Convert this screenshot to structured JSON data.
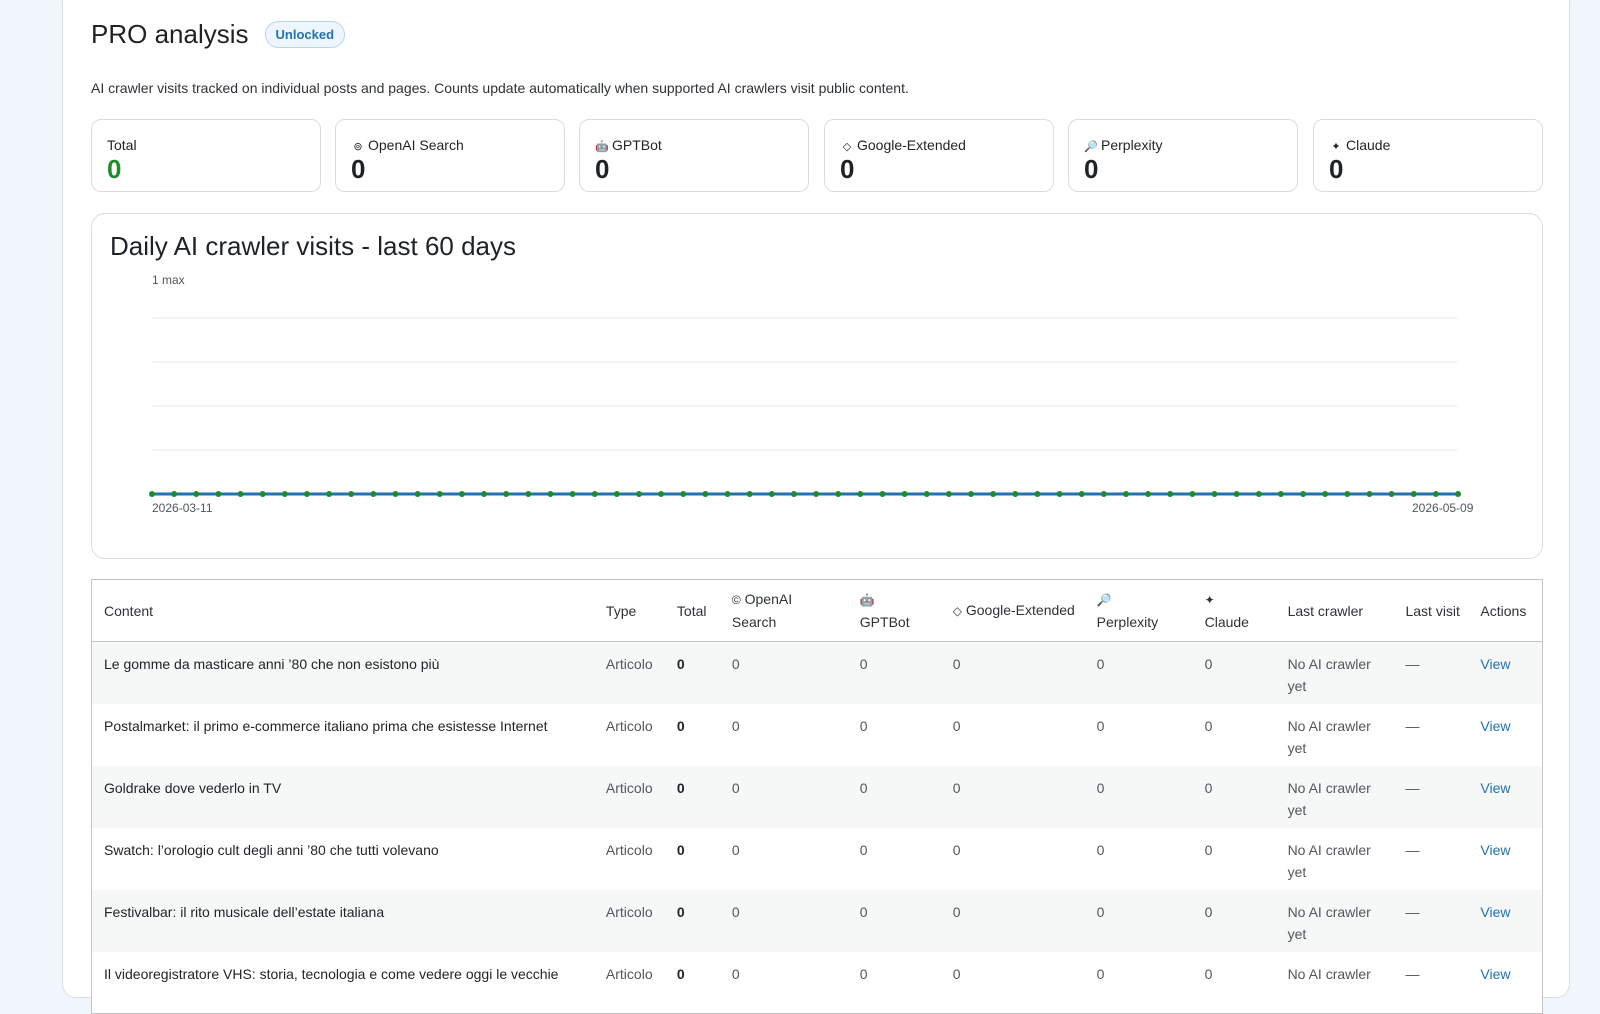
{
  "header": {
    "title": "PRO analysis",
    "badge": "Unlocked",
    "description": "AI crawler visits tracked on individual posts and pages. Counts update automatically when supported AI crawlers visit public content."
  },
  "stats": [
    {
      "label": "Total",
      "icon": "",
      "icon_name": "",
      "value": "0"
    },
    {
      "label": "OpenAI Search",
      "icon": "⊚",
      "icon_name": "openai-icon",
      "value": "0"
    },
    {
      "label": "GPTBot",
      "icon": "🤖",
      "icon_name": "robot-icon",
      "value": "0"
    },
    {
      "label": "Google-Extended",
      "icon": "◇",
      "icon_name": "diamond-icon",
      "value": "0"
    },
    {
      "label": "Perplexity",
      "icon": "🔎",
      "icon_name": "magnifier-icon",
      "value": "0"
    },
    {
      "label": "Claude",
      "icon": "✦",
      "icon_name": "sparkle-icon",
      "value": "0"
    }
  ],
  "chart": {
    "title": "Daily AI crawler visits - last 60 days",
    "max_label": "1 max",
    "start_label": "2026-03-11",
    "end_label": "2026-05-09"
  },
  "chart_data": {
    "type": "line",
    "title": "Daily AI crawler visits - last 60 days",
    "x_start": "2026-03-11",
    "x_end": "2026-05-09",
    "points": 60,
    "ylim": [
      0,
      1
    ],
    "series": [
      {
        "values": [
          0,
          0,
          0,
          0,
          0,
          0,
          0,
          0,
          0,
          0,
          0,
          0,
          0,
          0,
          0,
          0,
          0,
          0,
          0,
          0,
          0,
          0,
          0,
          0,
          0,
          0,
          0,
          0,
          0,
          0,
          0,
          0,
          0,
          0,
          0,
          0,
          0,
          0,
          0,
          0,
          0,
          0,
          0,
          0,
          0,
          0,
          0,
          0,
          0,
          0,
          0,
          0,
          0,
          0,
          0,
          0,
          0,
          0,
          0,
          0
        ]
      }
    ],
    "grid": true,
    "line_color": "#2271b1",
    "marker_color": "#1e8c2c"
  },
  "table": {
    "headers": {
      "content": "Content",
      "type": "Type",
      "total": "Total",
      "openai_icon": "©",
      "openai": "OpenAI Search",
      "gptbot_icon": "🤖",
      "gptbot": "GPTBot",
      "google_icon": "◇",
      "google": "Google-Extended",
      "perplexity_icon": "🔎",
      "perplexity": "Perplexity",
      "claude_icon": "✦",
      "claude": "Claude",
      "last_crawler": "Last crawler",
      "last_visit": "Last visit",
      "actions": "Actions"
    },
    "rows": [
      {
        "content": "Le gomme da masticare anni ’80 che non esistono più",
        "type": "Articolo",
        "total": "0",
        "openai": "0",
        "gptbot": "0",
        "google": "0",
        "perplexity": "0",
        "claude": "0",
        "last_crawler": "No AI crawler yet",
        "last_visit": "—",
        "action": "View"
      },
      {
        "content": "Postalmarket: il primo e-commerce italiano prima che esistesse Internet",
        "type": "Articolo",
        "total": "0",
        "openai": "0",
        "gptbot": "0",
        "google": "0",
        "perplexity": "0",
        "claude": "0",
        "last_crawler": "No AI crawler yet",
        "last_visit": "—",
        "action": "View"
      },
      {
        "content": "Goldrake dove vederlo in TV",
        "type": "Articolo",
        "total": "0",
        "openai": "0",
        "gptbot": "0",
        "google": "0",
        "perplexity": "0",
        "claude": "0",
        "last_crawler": "No AI crawler yet",
        "last_visit": "—",
        "action": "View"
      },
      {
        "content": "Swatch: l’orologio cult degli anni ’80 che tutti volevano",
        "type": "Articolo",
        "total": "0",
        "openai": "0",
        "gptbot": "0",
        "google": "0",
        "perplexity": "0",
        "claude": "0",
        "last_crawler": "No AI crawler yet",
        "last_visit": "—",
        "action": "View"
      },
      {
        "content": "Festivalbar: il rito musicale dell’estate italiana",
        "type": "Articolo",
        "total": "0",
        "openai": "0",
        "gptbot": "0",
        "google": "0",
        "perplexity": "0",
        "claude": "0",
        "last_crawler": "No AI crawler yet",
        "last_visit": "—",
        "action": "View"
      },
      {
        "content": "Il videoregistratore VHS: storia, tecnologia e come vedere oggi le vecchie",
        "type": "Articolo",
        "total": "0",
        "openai": "0",
        "gptbot": "0",
        "google": "0",
        "perplexity": "0",
        "claude": "0",
        "last_crawler": "No AI crawler",
        "last_visit": "—",
        "action": "View"
      }
    ]
  }
}
